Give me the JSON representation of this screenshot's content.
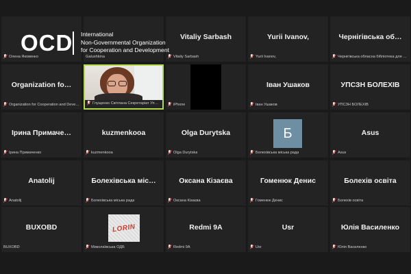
{
  "participants": [
    {
      "id": "olena",
      "tile_name": "",
      "label": "Олена Яковенко",
      "type": "ocd_logo",
      "muted": true
    },
    {
      "id": "galushkina",
      "tile_name": "",
      "label": "Galushkina",
      "type": "ocd_logo_continued",
      "muted": false
    },
    {
      "id": "vitaliy",
      "tile_name": "Vitaliy Sarbash",
      "label": "Vitaliy Sarbash",
      "type": "name",
      "muted": true
    },
    {
      "id": "yurii",
      "tile_name": "Yurii Ivanov,",
      "label": "Yurii Ivanov,",
      "type": "name",
      "muted": true
    },
    {
      "id": "chernihiv",
      "tile_name": "Чернігівська об…",
      "label": "Чернігівська обласна бібліотека для ді…",
      "type": "name",
      "muted": true
    },
    {
      "id": "org",
      "tile_name": "Organization fo…",
      "label": "Organization for Cooperation and Devel…",
      "type": "name",
      "muted": true
    },
    {
      "id": "glushchenko",
      "tile_name": "",
      "label": "Глущенко Світлана Секретаріат Уповнова…",
      "type": "video",
      "muted": true,
      "active": true
    },
    {
      "id": "iphone",
      "tile_name": "",
      "label": "iPhone",
      "type": "black",
      "muted": true
    },
    {
      "id": "ushakov",
      "tile_name": "Іван Ушаков",
      "label": "Іван Ушаков",
      "type": "name",
      "muted": true
    },
    {
      "id": "upszn",
      "tile_name": "УПСЗН БОЛЕХІВ",
      "label": "УПСЗН БОЛЕХІВ",
      "type": "name",
      "muted": true
    },
    {
      "id": "prymachenko",
      "tile_name": "Ірина  Примаче…",
      "label": "Ірина Примаченко",
      "type": "name",
      "muted": true
    },
    {
      "id": "kuzmenkooa",
      "tile_name": "kuzmenkooa",
      "label": "kuzmenkooa",
      "type": "name",
      "muted": true
    },
    {
      "id": "durytska",
      "tile_name": "Olga Durytska",
      "label": "Olga Durytska",
      "type": "name",
      "muted": true
    },
    {
      "id": "bolekhiv_rada1",
      "tile_name": "",
      "label": "Болехівська міська рада",
      "type": "avatar",
      "avatar_letter": "Б",
      "muted": true
    },
    {
      "id": "asus",
      "tile_name": "Asus",
      "label": "Asus",
      "type": "name",
      "muted": true
    },
    {
      "id": "anatolij",
      "tile_name": "Anatolij",
      "label": "Anatolij",
      "type": "name",
      "muted": true
    },
    {
      "id": "bolekhiv_rada2",
      "tile_name": "Болехівська міс…",
      "label": "Болехівська міська рада",
      "type": "name",
      "muted": true
    },
    {
      "id": "kizaeva",
      "tile_name": "Оксана Кізаєва",
      "label": "Оксана Кізаєва",
      "type": "name",
      "muted": true
    },
    {
      "id": "gomenyuk",
      "tile_name": "Гоменюк Денис",
      "label": "Гоменюк Денис",
      "type": "name",
      "muted": true
    },
    {
      "id": "bolekhiv_osvita",
      "tile_name": "Болехів освіта",
      "label": "Болехів освіта",
      "type": "name",
      "muted": true
    },
    {
      "id": "buxobd",
      "tile_name": "BUXOBD",
      "label": "BUXOBD",
      "type": "name",
      "muted": false
    },
    {
      "id": "mykolaiv",
      "tile_name": "",
      "label": "Миколаївська ОДБ",
      "type": "image",
      "image_text": "LORIN",
      "muted": true
    },
    {
      "id": "redmi",
      "tile_name": "Redmi 9A",
      "label": "Redmi 9A",
      "type": "name",
      "muted": true
    },
    {
      "id": "usr",
      "tile_name": "Usr",
      "label": "Usr",
      "type": "name",
      "muted": true
    },
    {
      "id": "vasylenko",
      "tile_name": "Юлія Василенко",
      "label": "Юлія Василенко",
      "type": "name",
      "muted": true
    }
  ],
  "ocd_logo": {
    "letters": "OCD",
    "line1": "International",
    "line2": "Non-Governmental Organization",
    "line3": "for Cooperation and Development"
  },
  "colors": {
    "active_speaker": "#b5d94c",
    "muted_mic": "#e0403a",
    "tile_bg": "#232323"
  }
}
